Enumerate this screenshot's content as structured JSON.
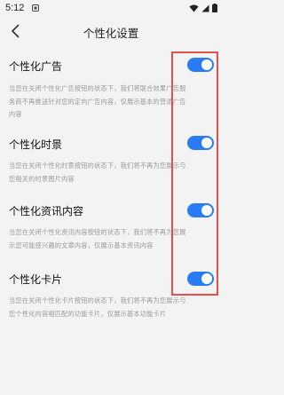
{
  "status_bar": {
    "time": "5:12"
  },
  "header": {
    "title": "个性化设置"
  },
  "settings": [
    {
      "title": "个性化广告",
      "desc_lines": [
        "当您在关闭个性化广告按钮的状态下，我们将联合效果广告服",
        "务商不再推送针对您的定向广告内容，仅展示基本的普通广告",
        "内容"
      ],
      "enabled": true
    },
    {
      "title": "个性化时景",
      "desc_lines": [
        "当您在关闭个性化时景按钮的状态下，我们将不再为您展示与",
        "您相关的时景图片内容"
      ],
      "enabled": true
    },
    {
      "title": "个性化资讯内容",
      "desc_lines": [
        "当您在关闭个性化资讯内容按钮的状态下，我们将不再为您展",
        "示您可能感兴趣的文章内容，仅展示基本资讯内容"
      ],
      "enabled": true
    },
    {
      "title": "个性化卡片",
      "desc_lines": [
        "当您在关闭个性化卡片按钮的状态下，我们将不再为您展示与",
        "您个性化内容相匹配的功能卡片，仅展示基本功能卡片"
      ],
      "enabled": true
    }
  ],
  "colors": {
    "toggle_on": "#2a7cf5",
    "highlight_border": "#e25050",
    "background": "#f3f3f3"
  }
}
